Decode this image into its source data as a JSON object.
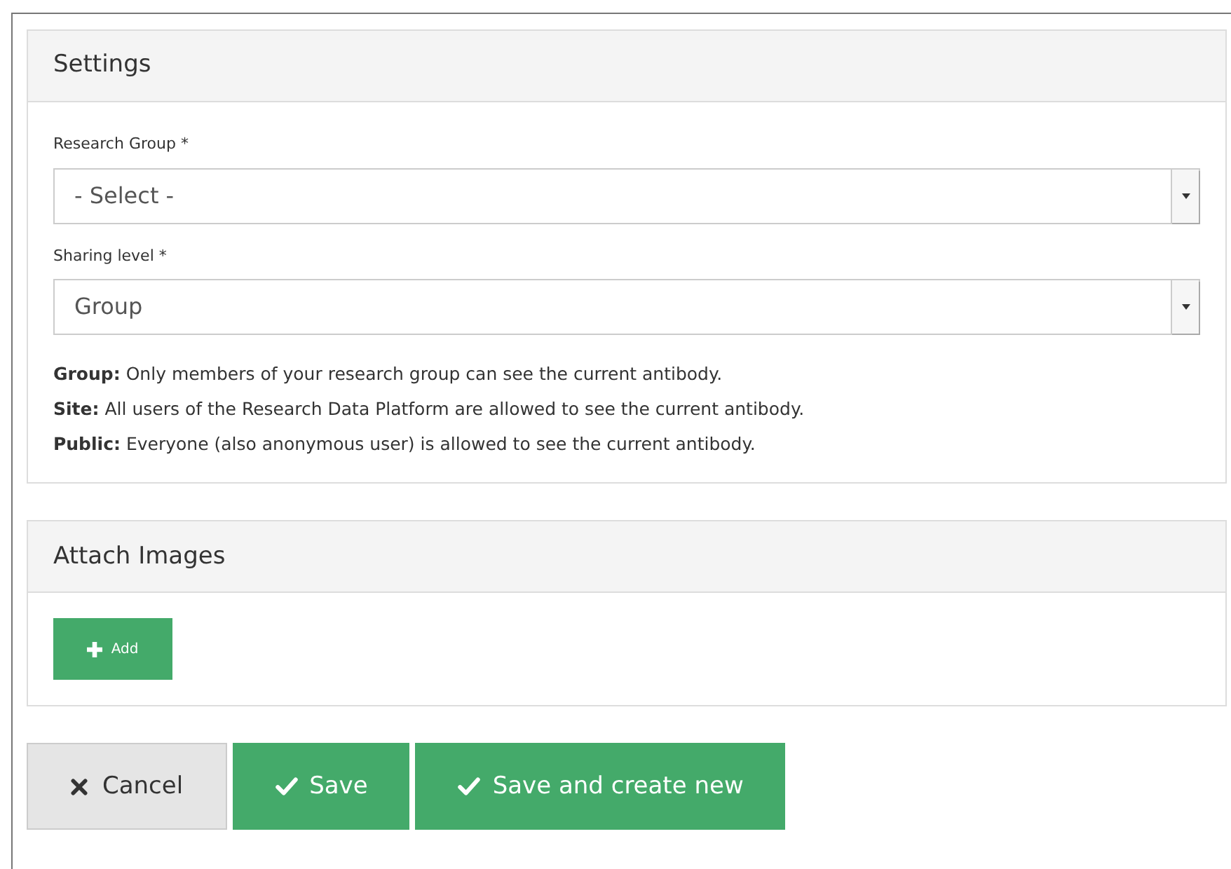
{
  "settings": {
    "title": "Settings",
    "fields": [
      {
        "label": "Research Group *",
        "value": "- Select -"
      },
      {
        "label": "Sharing level *",
        "value": "Group"
      }
    ],
    "help": [
      "**Group:** Only members of your research group can see the current antibody.",
      "**Site:** All users of the Research Data Platform are allowed to see the current antibody.",
      "**Public:** Everyone (also anonymous user) is allowed to see the current antibody."
    ]
  },
  "attach_images": {
    "title": "Attach Images",
    "add_button": "Add"
  },
  "actions": [
    {
      "kind": "cancel",
      "label": "Cancel"
    },
    {
      "kind": "confirm",
      "label": "Save"
    },
    {
      "kind": "confirm",
      "label": "Save and create new"
    }
  ]
}
